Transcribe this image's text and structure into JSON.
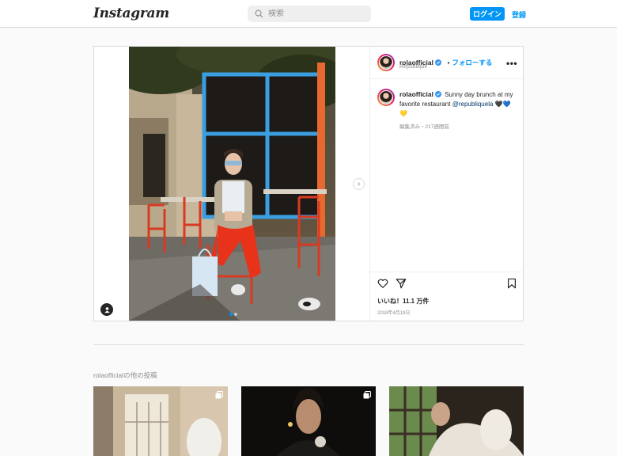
{
  "header": {
    "logo": "Instagram",
    "search_placeholder": "検索",
    "login_label": "ログイン",
    "signup_label": "登録"
  },
  "post": {
    "username": "rolaofficial",
    "follow_label": "フォローする",
    "separator": "•",
    "location": "République",
    "more_label": "•••",
    "caption": {
      "username": "rolaofficial",
      "text": "Sunny day brunch at my favorite restaurant ",
      "mention": "@republiquela",
      "emoji": "🖤💙💛"
    },
    "edited": "編集済み・217週間前",
    "likes": "いいね！11.1 万件",
    "date": "2018年4月19日",
    "carousel_index": 1,
    "carousel_count": 2
  },
  "more_posts": {
    "title": "rolaofficialの他の投稿"
  },
  "colors": {
    "accent": "#0095f6",
    "border": "#dbdbdb",
    "background": "#fafafa",
    "text": "#262626",
    "muted": "#8e8e8e"
  },
  "icons": [
    "search-icon",
    "verified-icon",
    "more-icon",
    "heart-icon",
    "share-icon",
    "bookmark-icon",
    "user-tag-icon",
    "chevron-right-icon",
    "multiple-posts-icon"
  ]
}
